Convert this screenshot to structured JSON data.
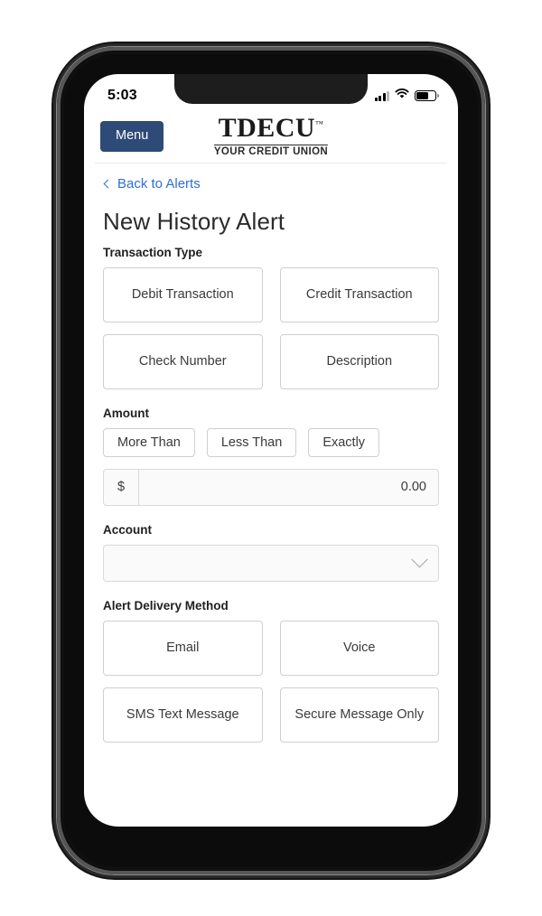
{
  "status_bar": {
    "time": "5:03",
    "cellular_icon": "cellular-bars-icon",
    "wifi_icon": "wifi-icon",
    "battery_icon": "battery-icon"
  },
  "header": {
    "menu_label": "Menu",
    "brand_name": "TDECU",
    "brand_trademark": "™",
    "brand_tagline": "YOUR CREDIT UNION",
    "menu_button_color": "#2e4a77"
  },
  "nav": {
    "back_label": "Back to Alerts",
    "back_icon": "chevron-left-icon",
    "link_color": "#2d6fd4"
  },
  "page": {
    "title": "New History Alert"
  },
  "transaction_type": {
    "label": "Transaction Type",
    "options": [
      {
        "label": "Debit Transaction"
      },
      {
        "label": "Credit Transaction"
      },
      {
        "label": "Check Number"
      },
      {
        "label": "Description"
      }
    ]
  },
  "amount": {
    "label": "Amount",
    "comparators": [
      {
        "label": "More Than"
      },
      {
        "label": "Less Than"
      },
      {
        "label": "Exactly"
      }
    ],
    "currency_prefix": "$",
    "value": "0.00"
  },
  "account": {
    "label": "Account",
    "selected": "",
    "dropdown_icon": "chevron-down-icon"
  },
  "delivery": {
    "label": "Alert Delivery Method",
    "options": [
      {
        "label": "Email"
      },
      {
        "label": "Voice"
      },
      {
        "label": "SMS Text Message"
      },
      {
        "label": "Secure Message Only"
      }
    ]
  }
}
